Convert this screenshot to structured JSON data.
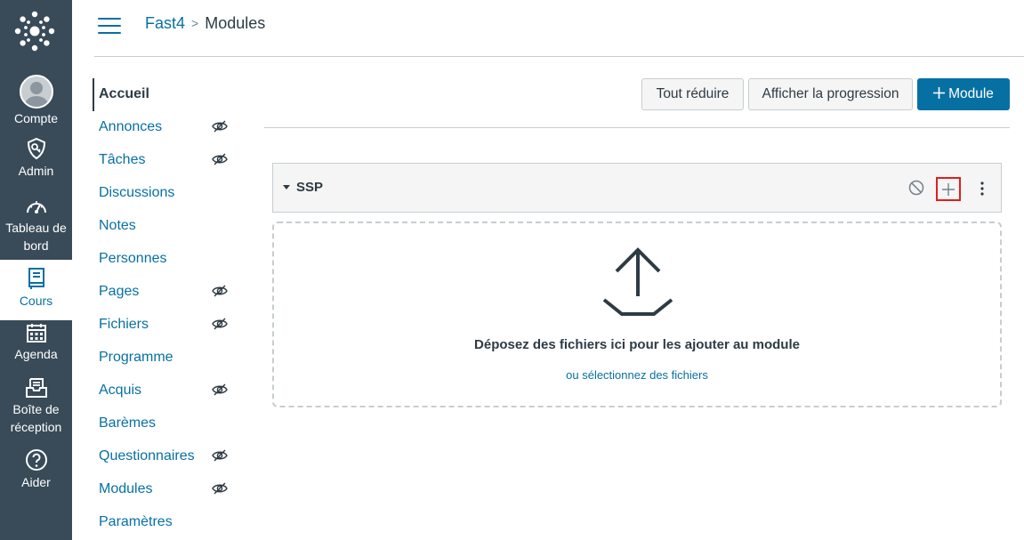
{
  "global_nav": {
    "items": [
      {
        "label": "Compte",
        "icon": "user-avatar-icon"
      },
      {
        "label": "Admin",
        "icon": "shield-icon"
      },
      {
        "label": "Tableau de bord",
        "line1": "Tableau de",
        "line2": "bord",
        "icon": "dashboard-icon"
      },
      {
        "label": "Cours",
        "icon": "book-icon",
        "active": true
      },
      {
        "label": "Agenda",
        "icon": "calendar-icon"
      },
      {
        "label": "Boîte de réception",
        "line1": "Boîte de",
        "line2": "réception",
        "icon": "inbox-icon"
      },
      {
        "label": "Aider",
        "icon": "help-icon"
      }
    ]
  },
  "breadcrumb": {
    "course": "Fast4",
    "separator": ">",
    "current": "Modules"
  },
  "course_nav": {
    "items": [
      {
        "label": "Accueil",
        "active": true,
        "hidden": false
      },
      {
        "label": "Annonces",
        "hidden": true
      },
      {
        "label": "Tâches",
        "hidden": true
      },
      {
        "label": "Discussions",
        "hidden": false
      },
      {
        "label": "Notes",
        "hidden": false
      },
      {
        "label": "Personnes",
        "hidden": false
      },
      {
        "label": "Pages",
        "hidden": true
      },
      {
        "label": "Fichiers",
        "hidden": true
      },
      {
        "label": "Programme",
        "hidden": false
      },
      {
        "label": "Acquis",
        "hidden": true
      },
      {
        "label": "Barèmes",
        "hidden": false
      },
      {
        "label": "Questionnaires",
        "hidden": true
      },
      {
        "label": "Modules",
        "hidden": true
      },
      {
        "label": "Paramètres",
        "hidden": false
      }
    ]
  },
  "toolbar": {
    "collapse_all": "Tout réduire",
    "show_progress": "Afficher la progression",
    "add_module": "Module"
  },
  "module": {
    "name": "SSP",
    "drop_message": "Déposez des fichiers ici pour les ajouter au module",
    "select_files": "ou sélectionnez des fichiers"
  },
  "colors": {
    "nav_bg": "#394b58",
    "brand_blue": "#0770a3",
    "highlight_red": "#e21d1d"
  }
}
